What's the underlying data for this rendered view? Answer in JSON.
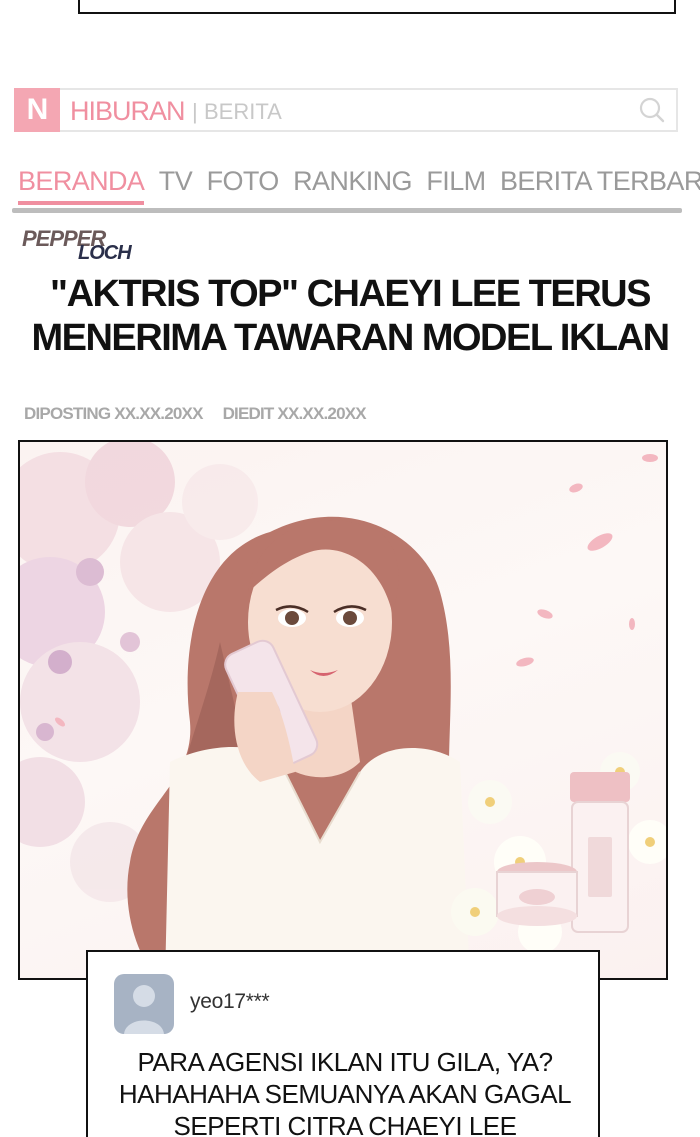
{
  "header": {
    "logo_letter": "N",
    "site_name": "HIBURAN",
    "separator": "|",
    "section": "BERITA"
  },
  "nav": {
    "items": [
      {
        "label": "BERANDA",
        "active": true
      },
      {
        "label": "TV",
        "active": false
      },
      {
        "label": "FOTO",
        "active": false
      },
      {
        "label": "RANKING",
        "active": false
      },
      {
        "label": "FILM",
        "active": false
      },
      {
        "label": "BERITA TERBARU",
        "active": false
      }
    ]
  },
  "brand": {
    "line1": "PEPPER",
    "line2": "LOCH"
  },
  "article": {
    "headline_line1": "\"AKTRIS TOP\" CHAEYI LEE TERUS",
    "headline_line2": "MENERIMA TAWARAN MODEL IKLAN",
    "posted": "DIPOSTING XX.XX.20XX",
    "edited": "DIEDIT XX.XX.20XX"
  },
  "comment": {
    "username": "yeo17***",
    "line1": "PARA AGENSI IKLAN ITU GILA, YA?",
    "line2": "HAHAHAHA SEMUANYA AKAN GAGAL",
    "line3": "SEPERTI CITRA CHAEYI LEE"
  },
  "colors": {
    "accent_pink": "#f08fa0",
    "logo_pink": "#f4a7b3",
    "muted_gray": "#9a9a9a",
    "avatar_gray": "#a7b3c4"
  },
  "icons": {
    "search": "search-icon",
    "avatar": "user-avatar-icon"
  }
}
